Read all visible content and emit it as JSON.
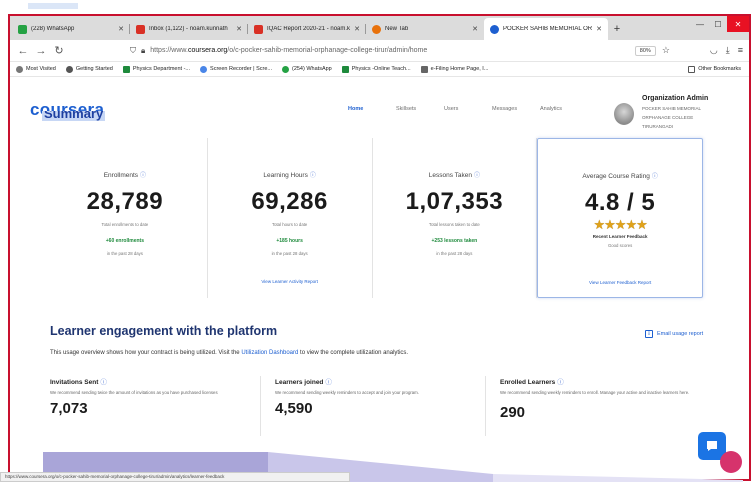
{
  "browser": {
    "tabs": [
      {
        "label": "(228) WhatsApp",
        "color": "#25a244"
      },
      {
        "label": "Inbox (1,122) - noam.kunnath",
        "color": "#d93025"
      },
      {
        "label": "IQAC Report 2020-21 - noam.k",
        "color": "#d93025"
      },
      {
        "label": "New Tab",
        "color": "#e8710a"
      },
      {
        "label": "POCKER SAHIB MEMORIAL OR",
        "color": "#1d5fd0"
      }
    ],
    "new_tab": "+",
    "url_prefix": "https://www.",
    "url_domain": "coursera.org",
    "url_path": "/o/c-pocker-sahib-memorial-orphanage-college-tirur/admin/home",
    "zoom": "80%",
    "bookmarks": [
      {
        "label": "Most Visited",
        "color": "#777777"
      },
      {
        "label": "Getting Started",
        "color": "#555555"
      },
      {
        "label": "Physics Department -...",
        "color": "#1e8a3c"
      },
      {
        "label": "Screen Recorder | Scre...",
        "color": "#4a86e8"
      },
      {
        "label": "(254) WhatsApp",
        "color": "#25a244"
      },
      {
        "label": "Physics -Online Teach...",
        "color": "#1e8a3c"
      },
      {
        "label": "e-Filing Home Page, I...",
        "color": "#666666"
      }
    ],
    "other_bookmarks": "Other Bookmarks",
    "status_url": "https://www.coursera.org/o/c-pocker-sahib-memorial-orphanage-college-tirur/admin/analytics/learner-feedback"
  },
  "app": {
    "logo": "coursera",
    "nav": [
      "Home",
      "Skillsets",
      "Users",
      "Messages",
      "Analytics"
    ],
    "org_title": "Organization Admin",
    "org_lines": [
      "POCKER SAHIB MEMORIAL",
      "ORPHANAGE COLLEGE",
      "TIRURANGADI"
    ],
    "summary_heading": "Summary"
  },
  "cards": [
    {
      "title": "Enrollments",
      "value": "28,789",
      "sub": "Total enrollments to date",
      "delta": "+60 enrollments",
      "period": "in the past 28 days",
      "link": ""
    },
    {
      "title": "Learning Hours",
      "value": "69,286",
      "sub": "Total hours to date",
      "delta": "+185 hours",
      "period": "in the past 28 days",
      "link": "View Learner Activity Report"
    },
    {
      "title": "Lessons Taken",
      "value": "1,07,353",
      "sub": "Total lessons taken to date",
      "delta": "+253 lessons taken",
      "period": "in the past 28 days",
      "link": ""
    }
  ],
  "rating": {
    "title": "Average Course Rating",
    "value": "4.8 / 5",
    "stars": "★★★★★",
    "sub1": "Recent Learner Feedback",
    "sub2": "Good scores",
    "link": "View Learner Feedback Report"
  },
  "engagement": {
    "title": "Learner engagement with the platform",
    "desc_before": "This usage overview shows how your contract is being utilized. Visit the ",
    "desc_link": "Utilization Dashboard",
    "desc_after": " to view the complete utilization analytics.",
    "email_link": "Email usage report",
    "stats": [
      {
        "title": "Invitations Sent",
        "desc": "We recommend sending twice the amount of invitations as you have purchased licenses",
        "value": "7,073"
      },
      {
        "title": "Learners joined",
        "desc": "We recommend sending weekly reminders to accept and join your program.",
        "value": "4,590"
      },
      {
        "title": "Enrolled Learners",
        "desc": "We recommend sending weekly reminders to enroll. Manage your active and inactive learners here.",
        "value": "290"
      }
    ]
  },
  "colors": {
    "brand": "#1d5fd0",
    "accent_green": "#1e8a3c",
    "frame": "#c8102e"
  }
}
